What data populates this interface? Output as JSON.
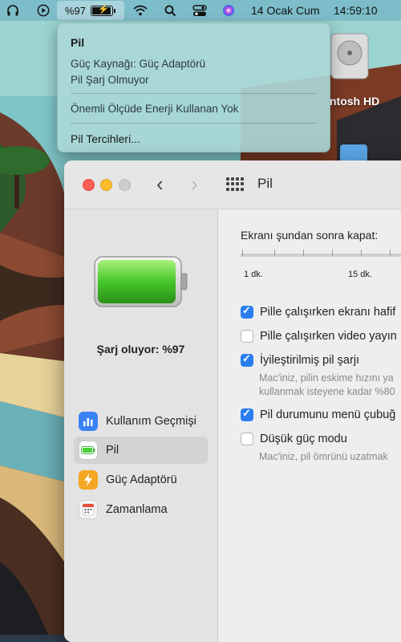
{
  "menubar": {
    "battery_percent": "%97",
    "date": "14 Ocak Cum",
    "time": "14:59:10",
    "icons": [
      "headphones-icon",
      "play-icon",
      "battery-charging-icon",
      "wifi-icon",
      "search-icon",
      "control-center-icon",
      "siri-icon"
    ]
  },
  "battery_menu": {
    "title": "Pil",
    "power_source": "Güç Kaynağı: Güç Adaptörü",
    "charge_state": "Pil Şarj Olmuyor",
    "energy_usage": "Önemli Ölçüde Enerji Kullanan Yok",
    "preferences": "Pil Tercihleri..."
  },
  "desktop": {
    "disk_label": "ntosh HD"
  },
  "window": {
    "title": "Pil",
    "charge_status": "Şarj oluyor: %97",
    "battery_level": 0.97,
    "sidebar": {
      "items": [
        {
          "label": "Kullanım Geçmişi",
          "icon": "bar-chart-icon",
          "color": "#3b82f6"
        },
        {
          "label": "Pil",
          "icon": "battery-icon",
          "color": "#4caf50",
          "selected": true
        },
        {
          "label": "Güç Adaptörü",
          "icon": "bolt-icon",
          "color": "#f5a623"
        },
        {
          "label": "Zamanlama",
          "icon": "calendar-icon",
          "color": "#e74c3c"
        }
      ]
    },
    "main": {
      "screen_off_label": "Ekranı şundan sonra kapat:",
      "slider_tick_labels": [
        "1 dk.",
        "15 dk."
      ],
      "options": [
        {
          "label": "Pille çalışırken ekranı hafif",
          "checked": true
        },
        {
          "label": "Pille çalışırken video yayın",
          "checked": false
        },
        {
          "label": "İyileştirilmiş pil şarjı",
          "checked": true,
          "description": [
            "Mac'iniz, pilin eskime hızını ya",
            "kullanmak isteyene kadar %80"
          ]
        },
        {
          "label": "Pil durumunu menü çubuğ",
          "checked": true
        },
        {
          "label": "Düşük güç modu",
          "checked": false,
          "description": [
            "Mac'iniz, pil ömrünü uzatmak"
          ]
        }
      ]
    }
  },
  "colors": {
    "accent": "#2a7ef0",
    "battery_green": "#4cd137",
    "close": "#fe5f57",
    "minimize": "#febc2e"
  }
}
